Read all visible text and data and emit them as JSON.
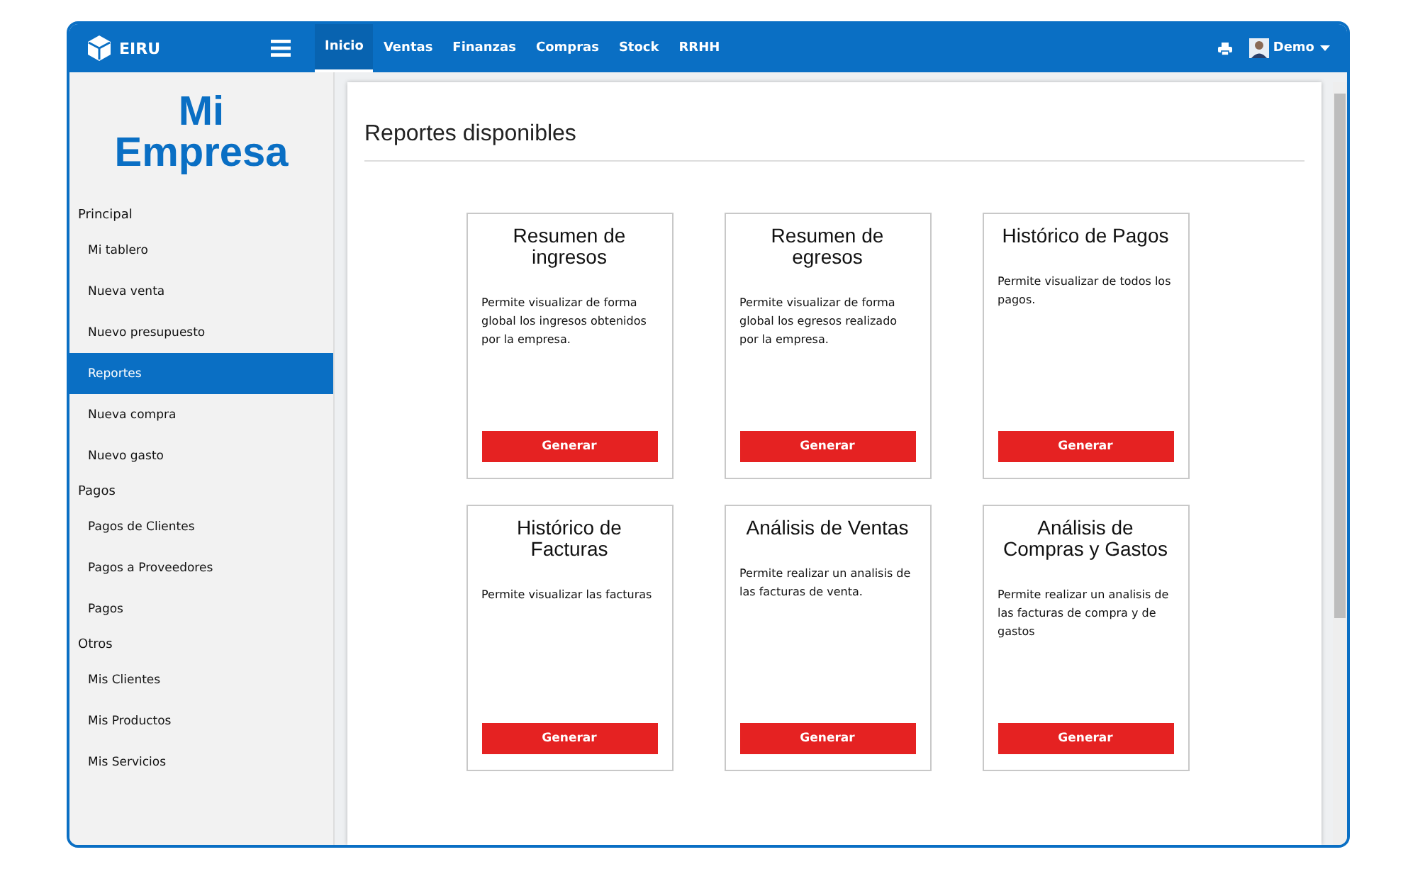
{
  "brand": "EIRU",
  "nav": [
    {
      "label": "Inicio",
      "selected": true
    },
    {
      "label": "Ventas",
      "selected": false
    },
    {
      "label": "Finanzas",
      "selected": false
    },
    {
      "label": "Compras",
      "selected": false
    },
    {
      "label": "Stock",
      "selected": false
    },
    {
      "label": "RRHH",
      "selected": false
    }
  ],
  "user": {
    "name": "Demo"
  },
  "sidebar": {
    "title_lines": [
      "Mi",
      "Empresa"
    ],
    "sections": [
      {
        "title": "Principal",
        "items": [
          {
            "label": "Mi tablero",
            "selected": false
          },
          {
            "label": "Nueva venta",
            "selected": false
          },
          {
            "label": "Nuevo presupuesto",
            "selected": false
          },
          {
            "label": "Reportes",
            "selected": true
          },
          {
            "label": "Nueva compra",
            "selected": false
          },
          {
            "label": "Nuevo gasto",
            "selected": false
          }
        ]
      },
      {
        "title": "Pagos",
        "items": [
          {
            "label": "Pagos de Clientes",
            "selected": false
          },
          {
            "label": "Pagos a Proveedores",
            "selected": false
          },
          {
            "label": "Pagos",
            "selected": false
          }
        ]
      },
      {
        "title": "Otros",
        "items": [
          {
            "label": "Mis Clientes",
            "selected": false
          },
          {
            "label": "Mis Productos",
            "selected": false
          },
          {
            "label": "Mis Servicios",
            "selected": false
          }
        ]
      }
    ]
  },
  "page_title": "Reportes disponibles",
  "reports": [
    {
      "title": "Resumen de ingresos",
      "description": "Permite visualizar de forma global los ingresos obtenidos por la empresa.",
      "button": "Generar"
    },
    {
      "title": "Resumen de egresos",
      "description": "Permite visualizar de forma global los egresos realizado por la empresa.",
      "button": "Generar"
    },
    {
      "title": "Histórico de Pagos",
      "description": "Permite visualizar de todos los pagos.",
      "button": "Generar"
    },
    {
      "title": "Histórico de Facturas",
      "description": "Permite visualizar las facturas",
      "button": "Generar"
    },
    {
      "title": "Análisis de Ventas",
      "description": "Permite realizar un analisis de las facturas de venta.",
      "button": "Generar"
    },
    {
      "title": "Análisis de Compras y Gastos",
      "description": "Permite realizar un analisis de las facturas de compra y de gastos",
      "button": "Generar"
    }
  ]
}
